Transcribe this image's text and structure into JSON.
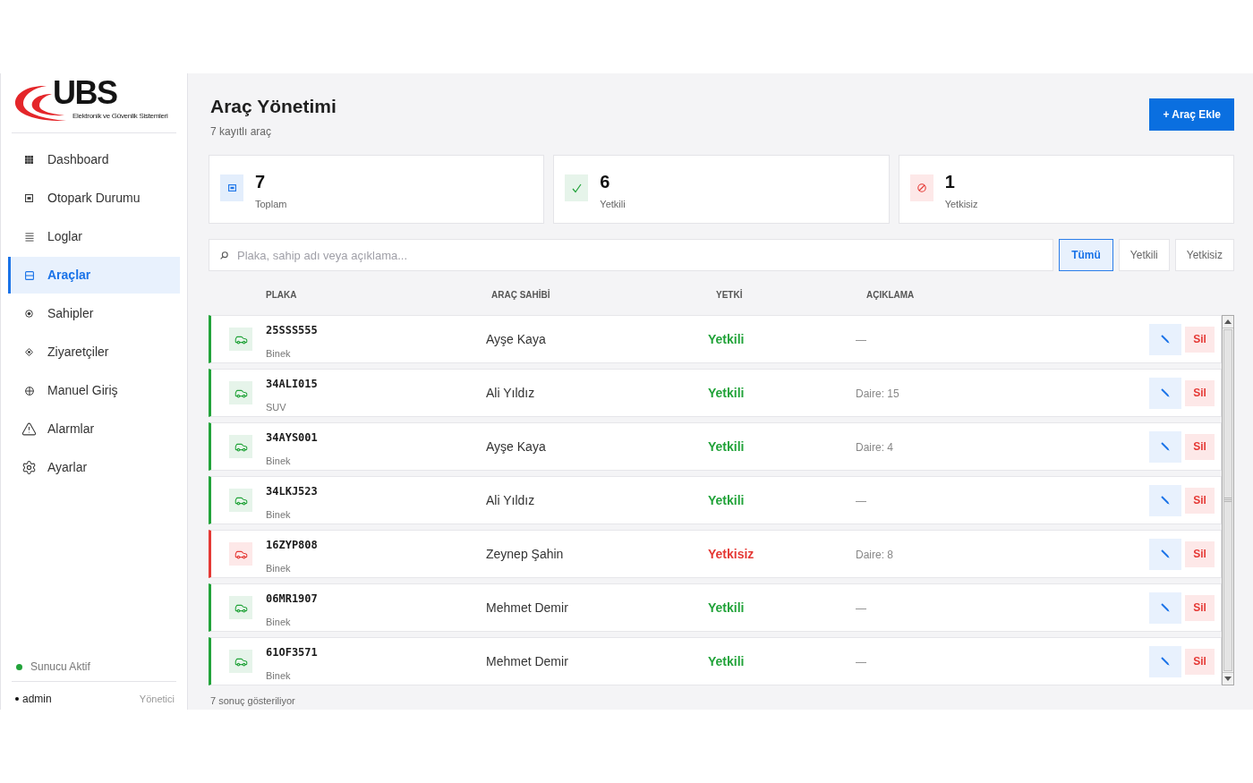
{
  "sidebar": {
    "logo": {
      "name": "UBS",
      "tagline": "Elektronik ve Güvenlik Sistemleri"
    },
    "nav": [
      {
        "label": "Dashboard",
        "selected": false
      },
      {
        "label": "Otopark Durumu",
        "selected": false
      },
      {
        "label": "Loglar",
        "selected": false
      },
      {
        "label": "Araçlar",
        "selected": true
      },
      {
        "label": "Sahipler",
        "selected": false
      },
      {
        "label": "Ziyaretçiler",
        "selected": false
      },
      {
        "label": "Manuel Giriş",
        "selected": false
      },
      {
        "label": "Alarmlar",
        "selected": false
      },
      {
        "label": "Ayarlar",
        "selected": false
      }
    ],
    "server_status": {
      "label": "Sunucu Aktif",
      "online": true
    },
    "user": {
      "name": "admin",
      "role": "Yönetici"
    }
  },
  "header": {
    "title": "Araç Yönetimi",
    "subtitle": "7 kayıtlı araç",
    "add_button": "+ Araç Ekle"
  },
  "stats": [
    {
      "kind": "total",
      "value": "7",
      "label": "Toplam"
    },
    {
      "kind": "authorized",
      "value": "6",
      "label": "Yetkili"
    },
    {
      "kind": "unauthorized",
      "value": "1",
      "label": "Yetkisiz"
    }
  ],
  "search": {
    "placeholder": "Plaka, sahip adı veya açıklama..."
  },
  "filters": [
    {
      "label": "Tümü",
      "selected": true
    },
    {
      "label": "Yetkili",
      "selected": false
    },
    {
      "label": "Yetkisiz",
      "selected": false
    }
  ],
  "table": {
    "columns": [
      "PLAKA",
      "ARAÇ SAHİBİ",
      "YETKİ",
      "AÇIKLAMA"
    ],
    "rows": [
      {
        "plate": "25SSS555",
        "type": "Binek",
        "owner": "Ayşe Kaya",
        "status": "Yetkili",
        "authorized": true,
        "note": "—",
        "delete_label": "Sil"
      },
      {
        "plate": "34ALI015",
        "type": "SUV",
        "owner": "Ali Yıldız",
        "status": "Yetkili",
        "authorized": true,
        "note": "Daire: 15",
        "delete_label": "Sil"
      },
      {
        "plate": "34AYS001",
        "type": "Binek",
        "owner": "Ayşe Kaya",
        "status": "Yetkili",
        "authorized": true,
        "note": "Daire: 4",
        "delete_label": "Sil"
      },
      {
        "plate": "34LKJ523",
        "type": "Binek",
        "owner": "Ali Yıldız",
        "status": "Yetkili",
        "authorized": true,
        "note": "—",
        "delete_label": "Sil"
      },
      {
        "plate": "16ZYP808",
        "type": "Binek",
        "owner": "Zeynep Şahin",
        "status": "Yetkisiz",
        "authorized": false,
        "note": "Daire: 8",
        "delete_label": "Sil"
      },
      {
        "plate": "06MR1907",
        "type": "Binek",
        "owner": "Mehmet Demir",
        "status": "Yetkili",
        "authorized": true,
        "note": "—",
        "delete_label": "Sil"
      },
      {
        "plate": "61OF3571",
        "type": "Binek",
        "owner": "Mehmet Demir",
        "status": "Yetkili",
        "authorized": true,
        "note": "—",
        "delete_label": "Sil"
      }
    ]
  },
  "footer": "7 sonuç gösteriliyor"
}
